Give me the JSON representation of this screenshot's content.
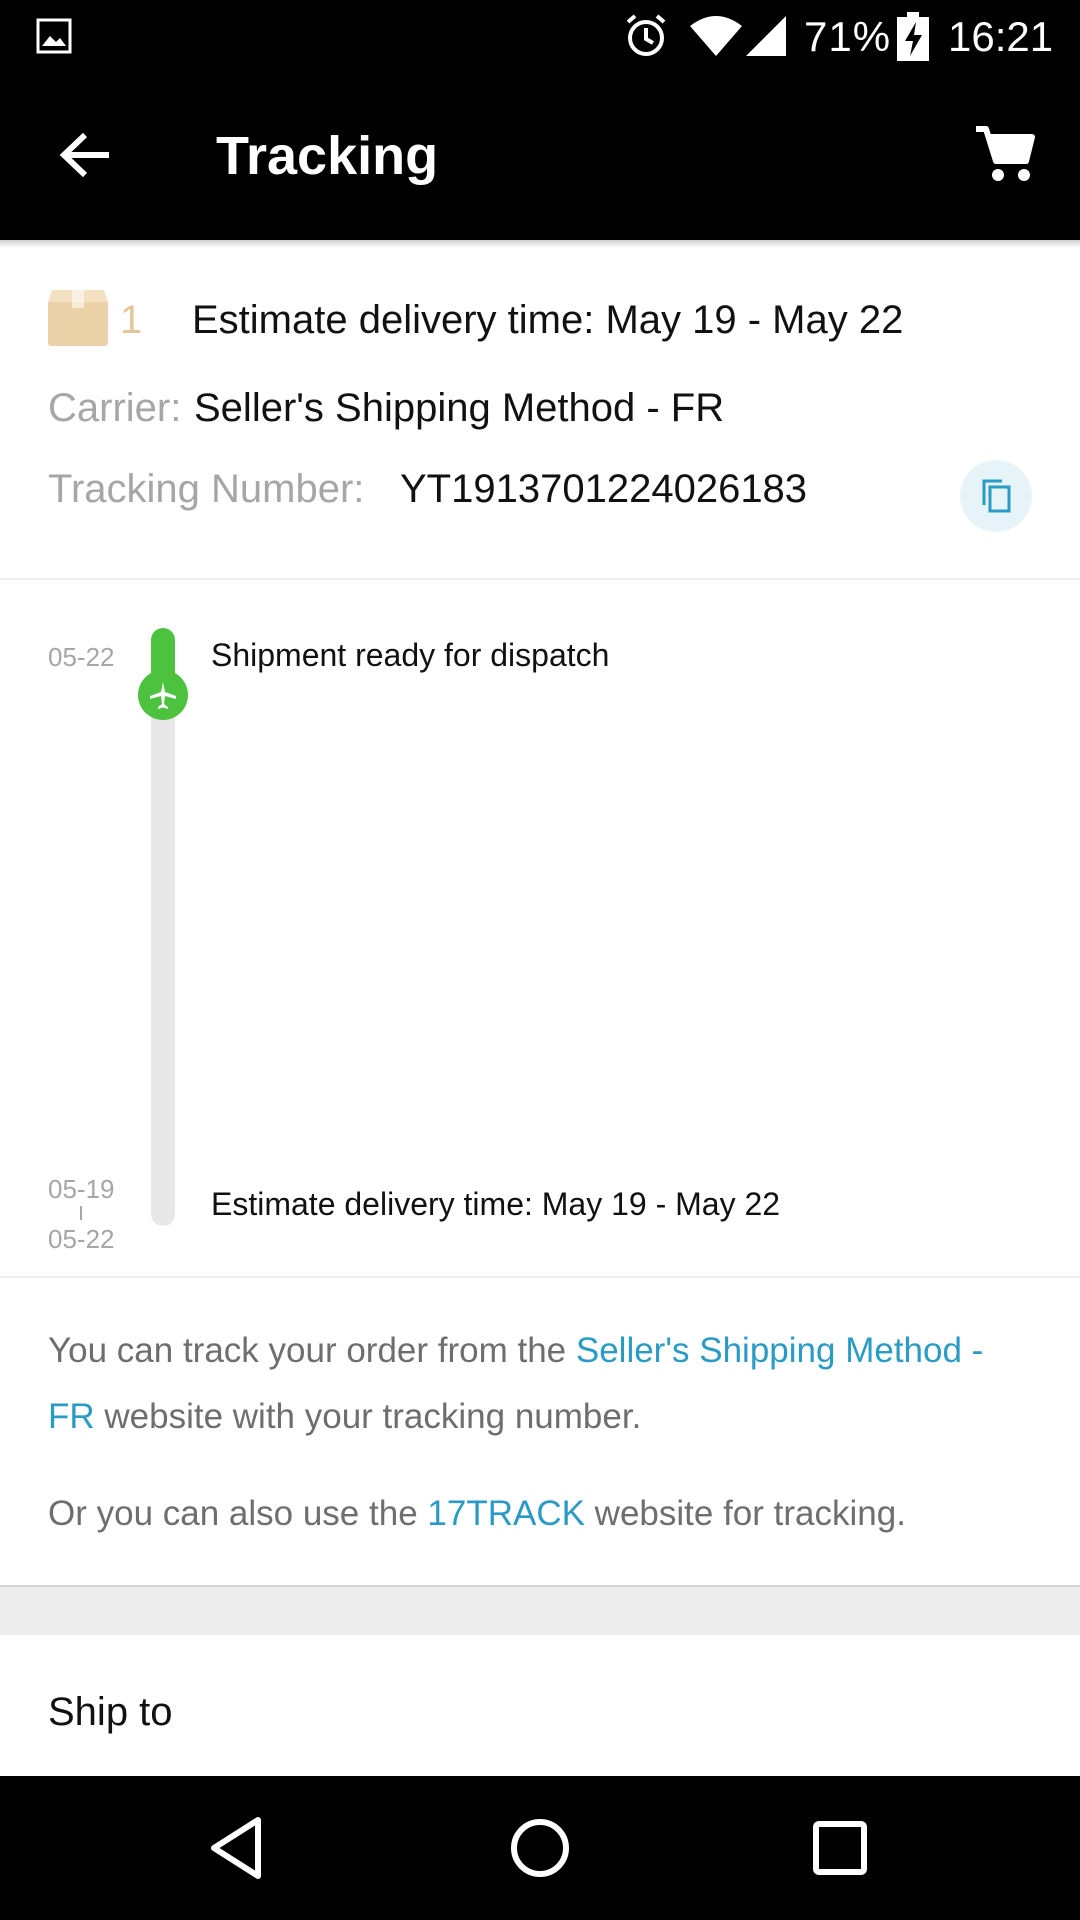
{
  "status_bar": {
    "battery_text": "71%",
    "time": "16:21",
    "icons": [
      "gallery-icon",
      "alarm-icon",
      "wifi-icon",
      "signal-icon",
      "battery-charging-icon"
    ]
  },
  "app_bar": {
    "title": "Tracking",
    "back_icon": "arrow-left-icon",
    "cart_icon": "shopping-cart-icon"
  },
  "package": {
    "count": "1",
    "estimate": "Estimate delivery time: May 19 - May 22",
    "carrier_label": "Carrier:",
    "carrier_value": "Seller's Shipping Method - FR",
    "tracking_label": "Tracking Number:",
    "tracking_value": "YT1913701224026183",
    "copy_icon": "copy-icon"
  },
  "timeline": {
    "events": [
      {
        "date": "05-22",
        "text": "Shipment ready for dispatch"
      },
      {
        "date_from": "05-19",
        "date_to": "05-22",
        "text": "Estimate delivery time: May 19 - May 22"
      }
    ]
  },
  "hints": {
    "line1_before": "You can track your order from the ",
    "line1_link": "Seller's Shipping Method - FR",
    "line1_after": " website with your tracking number.",
    "line2_before": "Or you can also use the ",
    "line2_link": "17TRACK",
    "line2_after": " website for tracking."
  },
  "ship_to": {
    "label": "Ship to"
  },
  "colors": {
    "accent_green": "#4cc23e",
    "link_blue": "#2a9bc4",
    "package_tan": "#e3c79a",
    "bar_black": "#000000"
  }
}
